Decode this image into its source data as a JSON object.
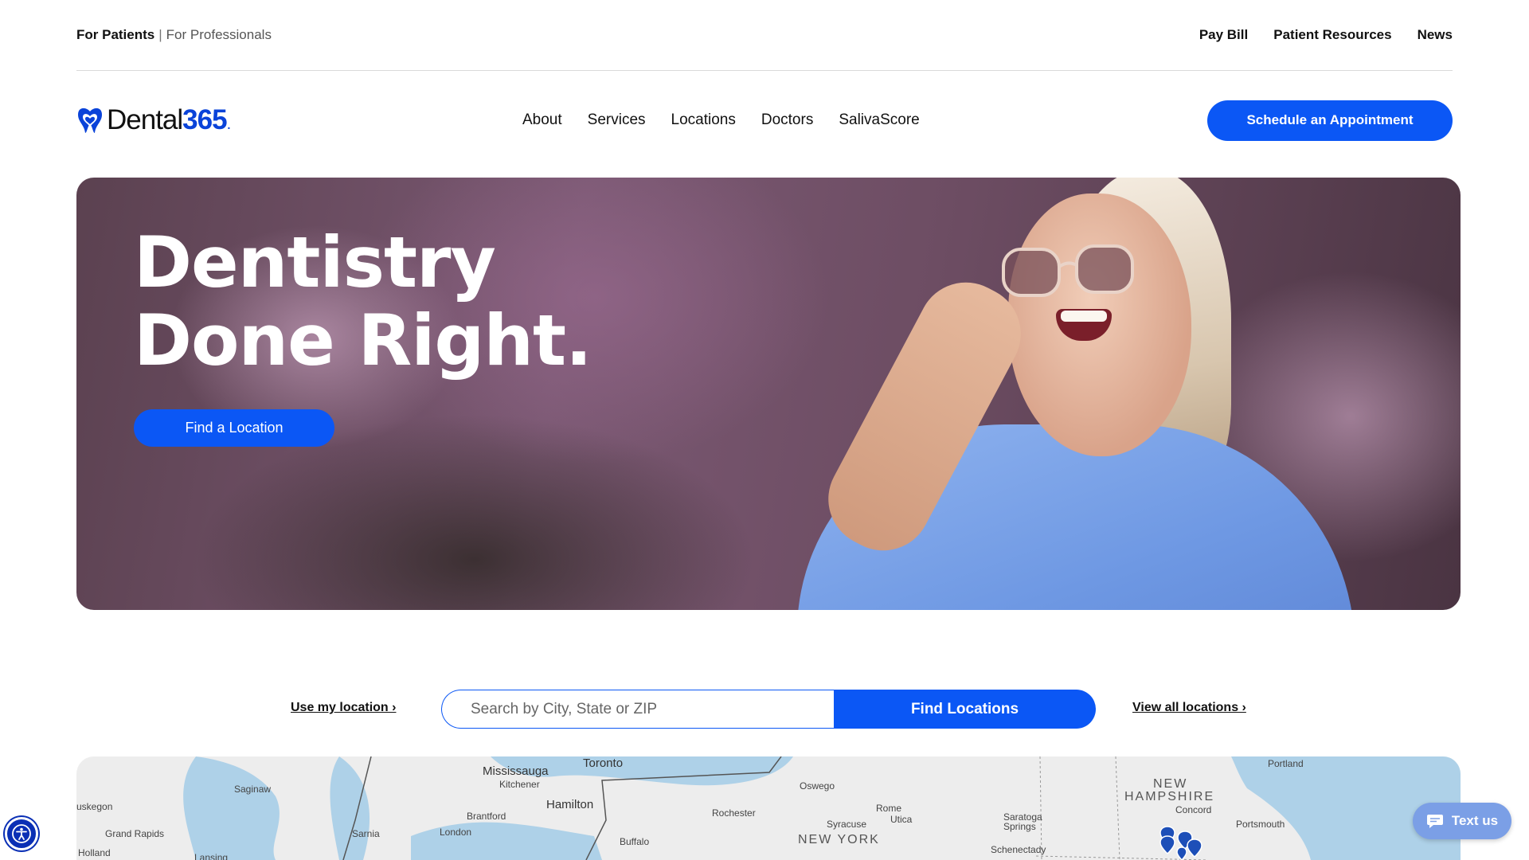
{
  "topbar": {
    "audience_active": "For Patients",
    "audience_sep": "|",
    "audience_other": "For Professionals",
    "links": [
      "Pay Bill",
      "Patient Resources",
      "News"
    ]
  },
  "header": {
    "logo_word": "Dental",
    "logo_num": "365",
    "logo_dot": ".",
    "nav": [
      "About",
      "Services",
      "Locations",
      "Doctors",
      "SalivaScore"
    ],
    "cta": "Schedule an Appointment"
  },
  "hero": {
    "line1": "Dentistry",
    "line2": "Done Right.",
    "cta": "Find a Location"
  },
  "search": {
    "use_location": "Use my location ›",
    "placeholder": "Search by City, State or ZIP",
    "button": "Find Locations",
    "view_all": "View all locations ›"
  },
  "map": {
    "labels": [
      "Mississauga",
      "Toronto",
      "Kitchener",
      "Saginaw",
      "Oswego",
      "Portland",
      "uskegon",
      "Hamilton",
      "Brantford",
      "Rochester",
      "Rome",
      "Utica",
      "Syracuse",
      "Saratoga Springs",
      "Concord",
      "Portsmouth",
      "Sarnia",
      "London",
      "Buffalo",
      "Grand Rapids",
      "Holland",
      "Lansing",
      "Schenectady"
    ],
    "states": [
      "NEW",
      "HAMPSHIRE",
      "NEW YORK"
    ]
  },
  "floating": {
    "text_us": "Text us"
  },
  "colors": {
    "accent": "#0b57f5",
    "logo_blue": "#0a43d9"
  }
}
